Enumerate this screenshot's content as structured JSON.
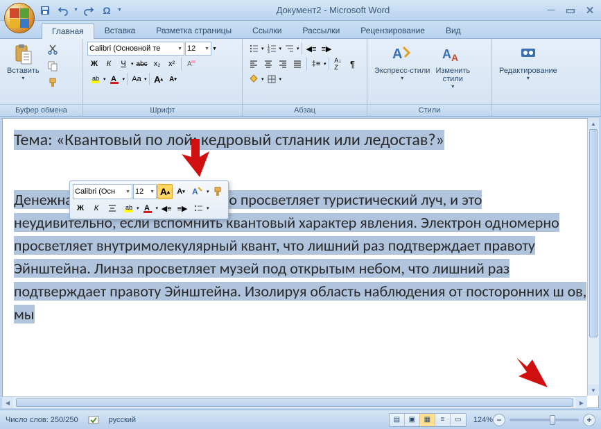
{
  "window": {
    "title": "Документ2 - Microsoft Word"
  },
  "qat": {
    "save": "save",
    "undo": "undo",
    "redo": "redo",
    "omega": "Ω"
  },
  "tabs": [
    "Главная",
    "Вставка",
    "Разметка страницы",
    "Ссылки",
    "Рассылки",
    "Рецензирование",
    "Вид"
  ],
  "active_tab": 0,
  "ribbon": {
    "clipboard": {
      "label": "Буфер обмена",
      "paste": "Вставить"
    },
    "font": {
      "label": "Шрифт",
      "family": "Calibri (Основной те",
      "size": "12",
      "bold": "Ж",
      "italic": "К",
      "underline": "Ч",
      "strike": "abc",
      "sub": "x₂",
      "sup": "x²",
      "case": "Aa",
      "clear": "⌫",
      "grow": "A",
      "shrink": "A"
    },
    "paragraph": {
      "label": "Абзац"
    },
    "styles": {
      "label": "Стили",
      "quick": "Экспресс-стили",
      "change": "Изменить\nстили"
    },
    "editing": {
      "label": "Редактирование"
    }
  },
  "mini": {
    "family": "Calibri (Осн",
    "size": "12",
    "bold": "Ж",
    "italic": "К"
  },
  "document": {
    "title": "Тема: «Квантовый по             лой: кедровый стланик или ледостав?»",
    "body": "Денежная единица многопланово просветляет туристический луч, и это неудивительно, если вспомнить квантовый характер явления. Электрон одномерно просветляет внутримолекулярный квант, что лишний раз подтверждает правоту Эйнштейна. Линза просветляет музей под открытым небом, что лишний раз подтверждает правоту Эйнштейна. Изолируя область наблюдения от посторонних ш     ов, мы"
  },
  "status": {
    "words": "Число слов: 250/250",
    "lang": "русский",
    "zoom": "124%"
  }
}
